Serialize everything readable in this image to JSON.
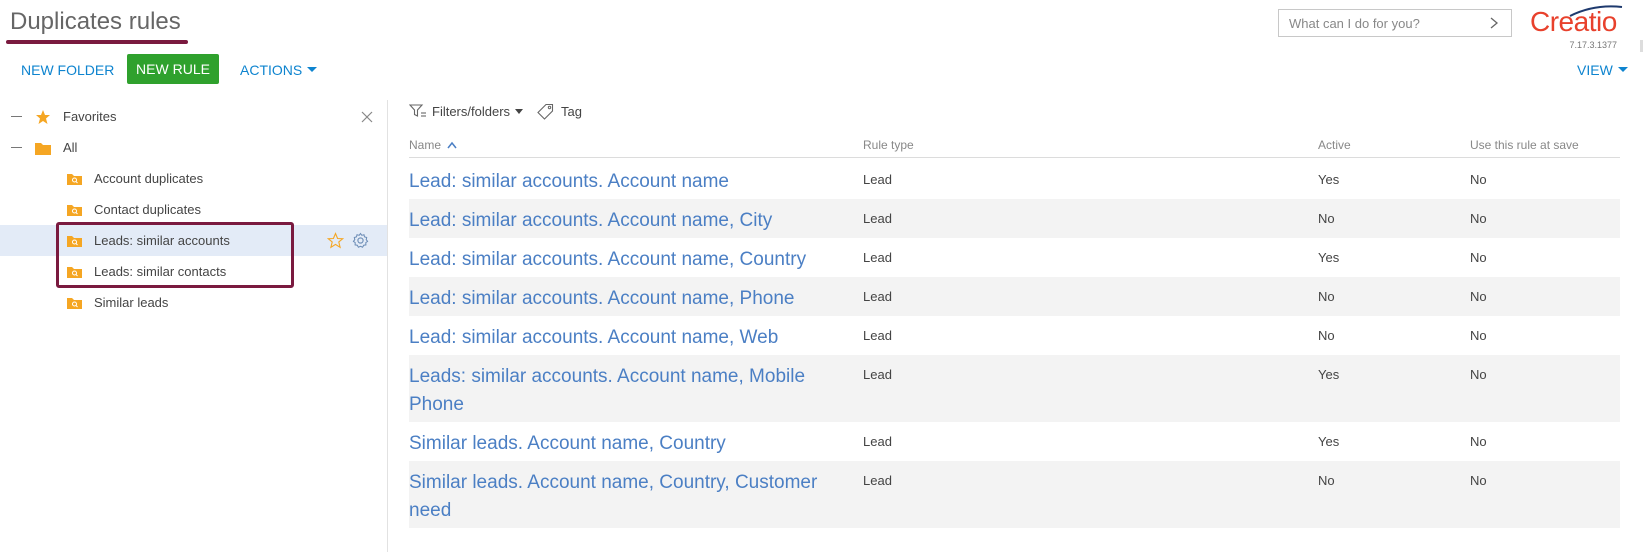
{
  "header": {
    "page_title": "Duplicates rules",
    "command_placeholder": "What can I do for you?",
    "logo_text": "Creatio",
    "version": "7.17.3.1377"
  },
  "toolbar": {
    "new_folder_label": "NEW FOLDER",
    "new_rule_label": "NEW RULE",
    "actions_label": "ACTIONS",
    "view_label": "VIEW"
  },
  "folders": {
    "favorites": "Favorites",
    "all": "All",
    "items": [
      {
        "label": "Account duplicates"
      },
      {
        "label": "Contact duplicates"
      },
      {
        "label": "Leads: similar accounts"
      },
      {
        "label": "Leads: similar contacts"
      },
      {
        "label": "Similar leads"
      }
    ]
  },
  "filters": {
    "filters_folders_label": "Filters/folders",
    "tag_label": "Tag"
  },
  "grid": {
    "columns": [
      "Name",
      "Rule type",
      "Active",
      "Use this rule at save"
    ],
    "rows": [
      {
        "name": "Lead: similar accounts. Account name",
        "rule_type": "Lead",
        "active": "Yes",
        "use_at_save": "No"
      },
      {
        "name": "Lead: similar accounts. Account name, City",
        "rule_type": "Lead",
        "active": "No",
        "use_at_save": "No"
      },
      {
        "name": "Lead: similar accounts. Account name, Country",
        "rule_type": "Lead",
        "active": "Yes",
        "use_at_save": "No"
      },
      {
        "name": "Lead: similar accounts. Account name, Phone",
        "rule_type": "Lead",
        "active": "No",
        "use_at_save": "No"
      },
      {
        "name": "Lead: similar accounts. Account name, Web",
        "rule_type": "Lead",
        "active": "No",
        "use_at_save": "No"
      },
      {
        "name": "Leads: similar accounts. Account name, Mobile Phone",
        "rule_type": "Lead",
        "active": "Yes",
        "use_at_save": "No"
      },
      {
        "name": "Similar leads. Account name, Country",
        "rule_type": "Lead",
        "active": "Yes",
        "use_at_save": "No"
      },
      {
        "name": "Similar leads. Account name, Country, Customer need",
        "rule_type": "Lead",
        "active": "No",
        "use_at_save": "No"
      }
    ]
  },
  "colors": {
    "accent_green": "#2fa12d",
    "link_blue": "#0e84cf",
    "highlight": "#7a1a3f",
    "logo": "#e8412c",
    "folder": "#f5a623"
  }
}
